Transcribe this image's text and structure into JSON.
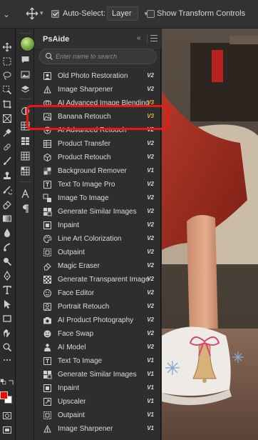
{
  "options_bar": {
    "auto_select_label": "Auto-Select:",
    "auto_select_checked": true,
    "layer_select_value": "Layer",
    "transform_controls_label": "Show Transform Controls",
    "transform_controls_checked": false
  },
  "colors": {
    "foreground": "#ff0000",
    "background": "#ffffff",
    "highlight": "#ee1515",
    "version_gold": "#e7b13a"
  },
  "panel": {
    "title": "PsAide",
    "search": {
      "placeholder": "Enter name to search",
      "value": ""
    },
    "highlighted_item": "Banana Retouch",
    "items": [
      {
        "label": "Old Photo Restoration",
        "version": "V2",
        "icon": "portrait-icon"
      },
      {
        "label": "Image Sharpener",
        "version": "V2",
        "icon": "sharpen-icon"
      },
      {
        "label": "AI Advanced Image Blending",
        "version": "V3",
        "icon": "blend-icon"
      },
      {
        "label": "Banana Retouch",
        "version": "V3",
        "icon": "image-icon"
      },
      {
        "label": "AI Advanced Retouch",
        "version": "V2",
        "icon": "retouch-icon"
      },
      {
        "label": "Product Transfer",
        "version": "V2",
        "icon": "transfer-icon"
      },
      {
        "label": "Product Retouch",
        "version": "V2",
        "icon": "product-icon"
      },
      {
        "label": "Background Remover",
        "version": "V1",
        "icon": "remove-bg-icon"
      },
      {
        "label": "Text To Image Pro",
        "version": "V2",
        "icon": "text-image-icon"
      },
      {
        "label": "Image To Image",
        "version": "V2",
        "icon": "image-to-image-icon"
      },
      {
        "label": "Generate Similar Images",
        "version": "V2",
        "icon": "similar-icon"
      },
      {
        "label": "Inpaint",
        "version": "V2",
        "icon": "inpaint-icon"
      },
      {
        "label": "Line Art Colorization",
        "version": "V2",
        "icon": "palette-icon"
      },
      {
        "label": "Outpaint",
        "version": "V2",
        "icon": "outpaint-icon"
      },
      {
        "label": "Magic Eraser",
        "version": "V2",
        "icon": "eraser-icon"
      },
      {
        "label": "Generate Transparent Image",
        "version": "V2",
        "icon": "transparent-icon"
      },
      {
        "label": "Face Editor",
        "version": "V2",
        "icon": "face-icon"
      },
      {
        "label": "Portrait Retouch",
        "version": "V2",
        "icon": "portrait-retouch-icon"
      },
      {
        "label": "AI Product Photography",
        "version": "V2",
        "icon": "camera-icon"
      },
      {
        "label": "Face Swap",
        "version": "V2",
        "icon": "face-swap-icon"
      },
      {
        "label": "AI Model",
        "version": "V2",
        "icon": "model-icon"
      },
      {
        "label": "Text To Image",
        "version": "V1",
        "icon": "text-image-icon"
      },
      {
        "label": "Generate Similar Images",
        "version": "V1",
        "icon": "similar-icon"
      },
      {
        "label": "Inpaint",
        "version": "V1",
        "icon": "inpaint-icon"
      },
      {
        "label": "Upscaler",
        "version": "V1",
        "icon": "upscale-icon"
      },
      {
        "label": "Outpaint",
        "version": "V1",
        "icon": "outpaint-icon"
      },
      {
        "label": "Image Sharpener",
        "version": "V1",
        "icon": "sharpen-icon"
      }
    ]
  }
}
